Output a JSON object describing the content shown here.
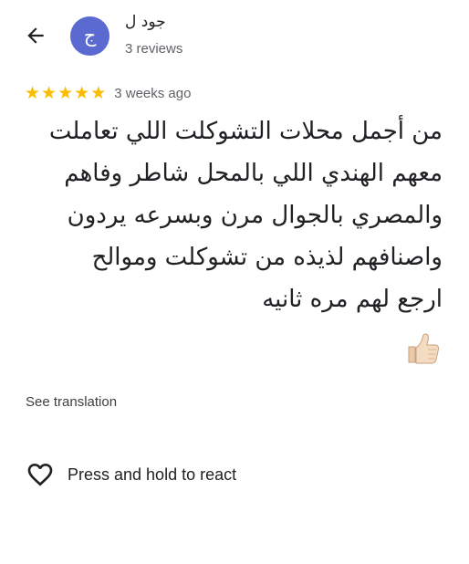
{
  "reviewer": {
    "name": "جود ل",
    "avatar_letter": "ج",
    "avatar_color": "#5b6ad0",
    "reviews_count": "3 reviews"
  },
  "review": {
    "rating": 5,
    "max_rating": 5,
    "star_color": "#fbbc04",
    "date": "3 weeks ago",
    "text": "من أجمل محلات التشوكلت اللي تعاملت معهم الهندي اللي بالمحل شاطر وفاهم والمصري بالجوال مرن وبسرعه يردون واصنافهم لذيذه من تشوكلت وموالح ارجع لهم مره ثانيه",
    "emoji": "thumbs-up-icon"
  },
  "actions": {
    "see_translation": "See translation",
    "react_label": "Press and hold to react"
  },
  "icons": {
    "back": "arrow-left-icon",
    "react": "heart-outline-icon"
  }
}
